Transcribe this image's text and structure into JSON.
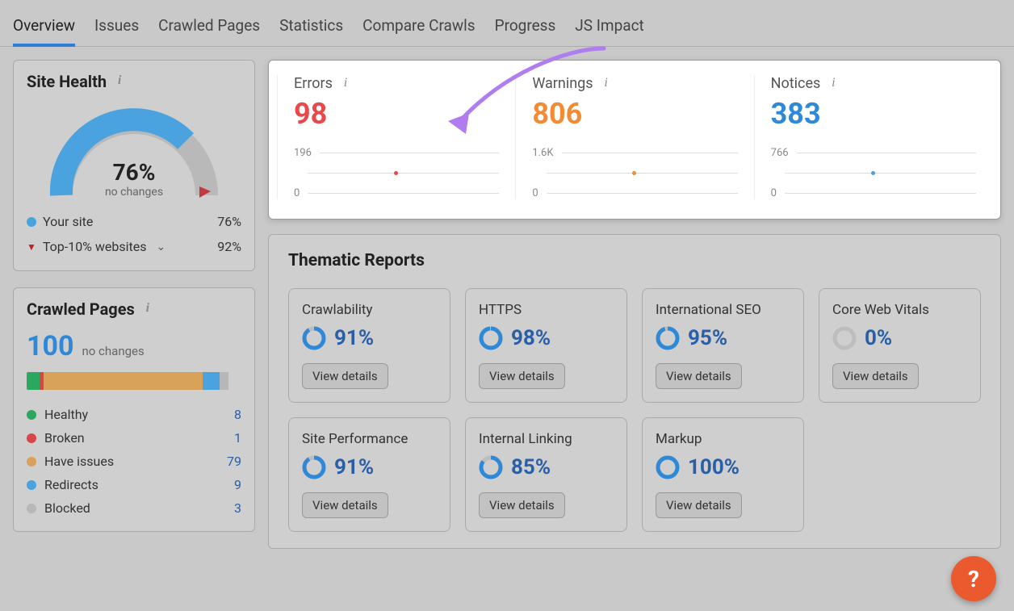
{
  "tabs": [
    "Overview",
    "Issues",
    "Crawled Pages",
    "Statistics",
    "Compare Crawls",
    "Progress",
    "JS Impact"
  ],
  "site_health": {
    "title": "Site Health",
    "percent": "76%",
    "sub": "no changes",
    "legend_your_site_label": "Your site",
    "legend_your_site_value": "76%",
    "legend_top10_label": "Top-10% websites",
    "legend_top10_value": "92%"
  },
  "crawled_pages": {
    "title": "Crawled Pages",
    "value": "100",
    "sub": "no changes",
    "segments": [
      {
        "label": "Healthy",
        "count": "8",
        "color": "#2aa85f",
        "width": 6
      },
      {
        "label": "Broken",
        "count": "1",
        "color": "#d94646",
        "width": 2
      },
      {
        "label": "Have issues",
        "count": "79",
        "color": "#d9a25a",
        "width": 74
      },
      {
        "label": "Redirects",
        "count": "9",
        "color": "#4aa2df",
        "width": 8
      },
      {
        "label": "Blocked",
        "count": "3",
        "color": "#b7b7b7",
        "width": 4
      }
    ]
  },
  "alerts": {
    "errors": {
      "label": "Errors",
      "value": "98",
      "axis_top": "196",
      "axis_bottom": "0"
    },
    "warnings": {
      "label": "Warnings",
      "value": "806",
      "axis_top": "1.6K",
      "axis_bottom": "0"
    },
    "notices": {
      "label": "Notices",
      "value": "383",
      "axis_top": "766",
      "axis_bottom": "0"
    }
  },
  "thematic": {
    "title": "Thematic Reports",
    "button_label": "View details",
    "reports": [
      {
        "title": "Crawlability",
        "value": "91%",
        "pct": 91,
        "color": "#2f89d6"
      },
      {
        "title": "HTTPS",
        "value": "98%",
        "pct": 98,
        "color": "#2f89d6"
      },
      {
        "title": "International SEO",
        "value": "95%",
        "pct": 95,
        "color": "#2f89d6"
      },
      {
        "title": "Core Web Vitals",
        "value": "0%",
        "pct": 0,
        "color": "#aaaaaa"
      },
      {
        "title": "Site Performance",
        "value": "91%",
        "pct": 91,
        "color": "#2f89d6"
      },
      {
        "title": "Internal Linking",
        "value": "85%",
        "pct": 85,
        "color": "#2f89d6"
      },
      {
        "title": "Markup",
        "value": "100%",
        "pct": 100,
        "color": "#2f89d6"
      }
    ]
  },
  "chart_data": [
    {
      "type": "pie",
      "title": "Site Health",
      "series": [
        {
          "name": "Your site",
          "values": [
            76
          ]
        },
        {
          "name": "Top-10% websites",
          "values": [
            92
          ]
        }
      ],
      "ylim": [
        0,
        100
      ]
    },
    {
      "type": "bar",
      "title": "Crawled Pages breakdown",
      "categories": [
        "Healthy",
        "Broken",
        "Have issues",
        "Redirects",
        "Blocked"
      ],
      "values": [
        8,
        1,
        79,
        9,
        3
      ]
    },
    {
      "type": "line",
      "title": "Errors trend",
      "x": [
        1
      ],
      "values": [
        98
      ],
      "ylim": [
        0,
        196
      ]
    },
    {
      "type": "line",
      "title": "Warnings trend",
      "x": [
        1
      ],
      "values": [
        806
      ],
      "ylim": [
        0,
        1600
      ]
    },
    {
      "type": "line",
      "title": "Notices trend",
      "x": [
        1
      ],
      "values": [
        383
      ],
      "ylim": [
        0,
        766
      ]
    }
  ]
}
